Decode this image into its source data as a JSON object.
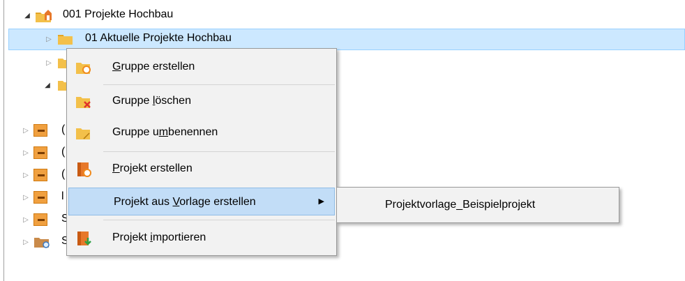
{
  "tree": {
    "root": {
      "label": "001 Projekte Hochbau",
      "expander": "expanded",
      "icon": "project-folder-icon"
    },
    "selected_child": {
      "label": "01 Aktuelle Projekte Hochbau",
      "expander": "collapsed",
      "icon": "folder-icon"
    },
    "partial_children": [
      {
        "icon": "folder-icon",
        "expander": "collapsed"
      },
      {
        "icon": "folder-icon",
        "expander": "expanded"
      },
      {
        "icon": "project-box-icon",
        "expander": "collapsed",
        "visible_text": "("
      },
      {
        "icon": "project-box-icon",
        "expander": "collapsed",
        "visible_text": "("
      },
      {
        "icon": "project-box-icon",
        "expander": "collapsed",
        "visible_text": "("
      },
      {
        "icon": "project-box-icon",
        "expander": "collapsed",
        "visible_text": "l"
      },
      {
        "icon": "project-box-icon",
        "expander": "collapsed",
        "visible_text": "S"
      },
      {
        "icon": "search-folder-icon",
        "expander": "collapsed",
        "visible_text": "S"
      }
    ]
  },
  "context_menu": {
    "items": [
      {
        "pre": "",
        "accel": "G",
        "post": "ruppe erstellen",
        "icon": "add-group-icon"
      },
      {
        "pre": "Gruppe ",
        "accel": "l",
        "post": "öschen",
        "icon": "delete-group-icon"
      },
      {
        "pre": "Gruppe u",
        "accel": "m",
        "post": "benennen",
        "icon": "rename-group-icon"
      },
      {
        "pre": "",
        "accel": "P",
        "post": "rojekt erstellen",
        "icon": "create-project-icon"
      },
      {
        "pre": "Projekt aus ",
        "accel": "V",
        "post": "orlage erstellen",
        "icon": "",
        "submenu": true
      },
      {
        "pre": "Projekt ",
        "accel": "i",
        "post": "mportieren",
        "icon": "import-project-icon"
      }
    ]
  },
  "submenu": {
    "items": [
      {
        "label": "Projektvorlage_Beispielprojekt"
      }
    ]
  },
  "colors": {
    "selection_bg": "#cce8ff",
    "selection_border": "#99d1ff",
    "menu_bg": "#f2f2f2",
    "menu_highlight": "#c2ddf7",
    "folder_yellow": "#f3c04a",
    "box_orange": "#f0a040",
    "delete_red": "#e0322b",
    "import_green": "#2ea043"
  }
}
